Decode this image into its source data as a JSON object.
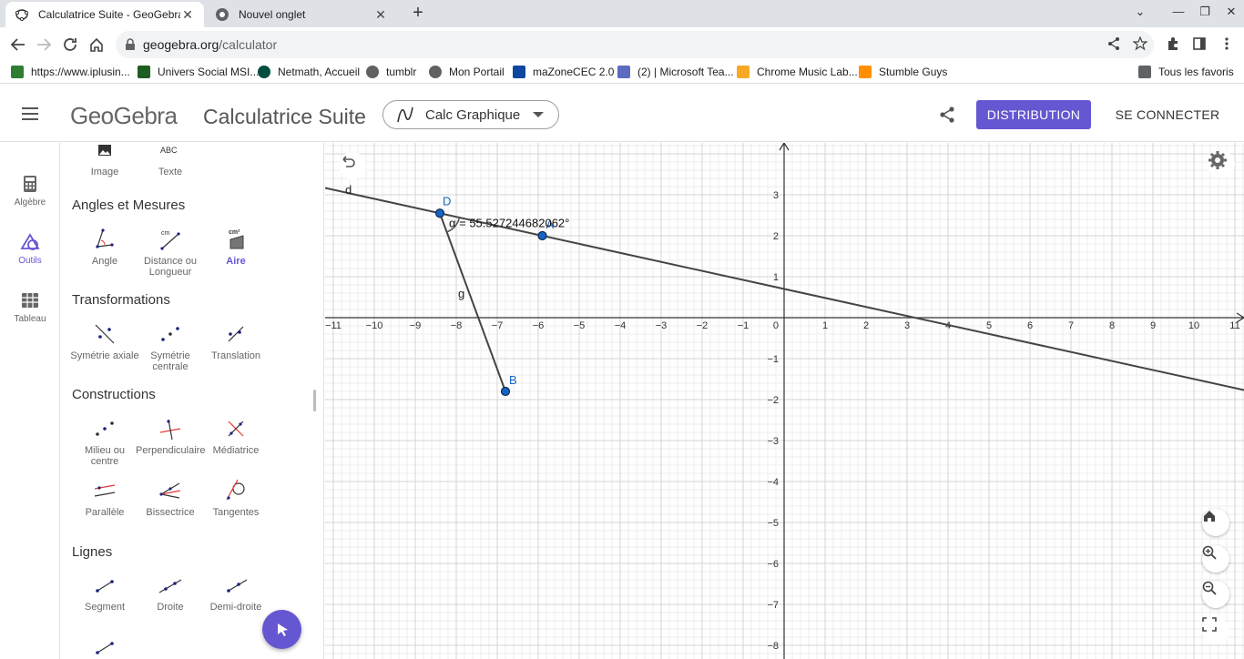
{
  "browser": {
    "tabs": [
      {
        "title": "Calculatrice Suite - GeoGebra",
        "active": true
      },
      {
        "title": "Nouvel onglet",
        "active": false
      }
    ],
    "url_host": "geogebra.org",
    "url_path": "/calculator",
    "bookmarks": [
      {
        "label": "https://www.iplusin...",
        "color": "#2e7d32"
      },
      {
        "label": "Univers Social MSI...",
        "color": "#1b5e20"
      },
      {
        "label": "Netmath, Accueil",
        "color": "#004d40"
      },
      {
        "label": "tumblr",
        "color": "#616161"
      },
      {
        "label": "Mon Portail",
        "color": "#616161"
      },
      {
        "label": "maZoneCEC 2.0",
        "color": "#0d47a1"
      },
      {
        "label": "(2) | Microsoft Tea...",
        "color": "#5c6bc0"
      },
      {
        "label": "Chrome Music Lab...",
        "color": "#f9a825"
      },
      {
        "label": "Stumble Guys",
        "color": "#ff8f00"
      }
    ],
    "all_bookmarks": "Tous les favoris"
  },
  "header": {
    "logo": "GeoGebra",
    "app_title": "Calculatrice Suite",
    "app_selector": "Calc Graphique",
    "distribution_button": "DISTRIBUTION",
    "login_button": "SE CONNECTER",
    "accent": "#6557d2"
  },
  "rail": [
    {
      "label": "Algèbre",
      "icon": "calculator-icon",
      "active": false
    },
    {
      "label": "Outils",
      "icon": "tools-icon",
      "active": true
    },
    {
      "label": "Tableau",
      "icon": "table-icon",
      "active": false
    }
  ],
  "tools": {
    "top_row": [
      {
        "label": "Image"
      },
      {
        "label": "Texte"
      }
    ],
    "sections": [
      {
        "title": "Angles et Mesures",
        "items": [
          "Angle",
          "Distance ou Longueur",
          "Aire"
        ]
      },
      {
        "title": "Transformations",
        "items": [
          "Symétrie axiale",
          "Symétrie centrale",
          "Translation"
        ]
      },
      {
        "title": "Constructions",
        "items": [
          "Milieu ou centre",
          "Perpendiculaire",
          "Médiatrice",
          "Parallèle",
          "Bissectrice",
          "Tangentes"
        ]
      },
      {
        "title": "Lignes",
        "items": [
          "Segment",
          "Droite",
          "Demi-droite"
        ]
      }
    ],
    "selected_tool": "Aire"
  },
  "graphics": {
    "labels": {
      "line_d": "d",
      "segment_g": "g",
      "point_D": "D",
      "point_A": "A",
      "point_B": "B",
      "angle_text": "α = 55.52724468​2062°"
    },
    "points": {
      "D": [
        -8.4,
        2.55
      ],
      "A": [
        -5.9,
        2.0
      ],
      "B": [
        -6.8,
        -1.8
      ]
    },
    "x_ticks": [
      -11,
      -10,
      -9,
      -8,
      -7,
      -6,
      -5,
      -4,
      -3,
      -2,
      -1,
      0,
      1,
      2,
      3,
      4,
      5,
      6,
      7,
      8,
      9,
      10,
      11
    ],
    "y_ticks": [
      3,
      2,
      1,
      -1,
      -2,
      -3,
      -4,
      -5,
      -6,
      -7,
      -8
    ],
    "origin_label": "0",
    "point_color": "#1565c0",
    "line_color": "#444444"
  }
}
